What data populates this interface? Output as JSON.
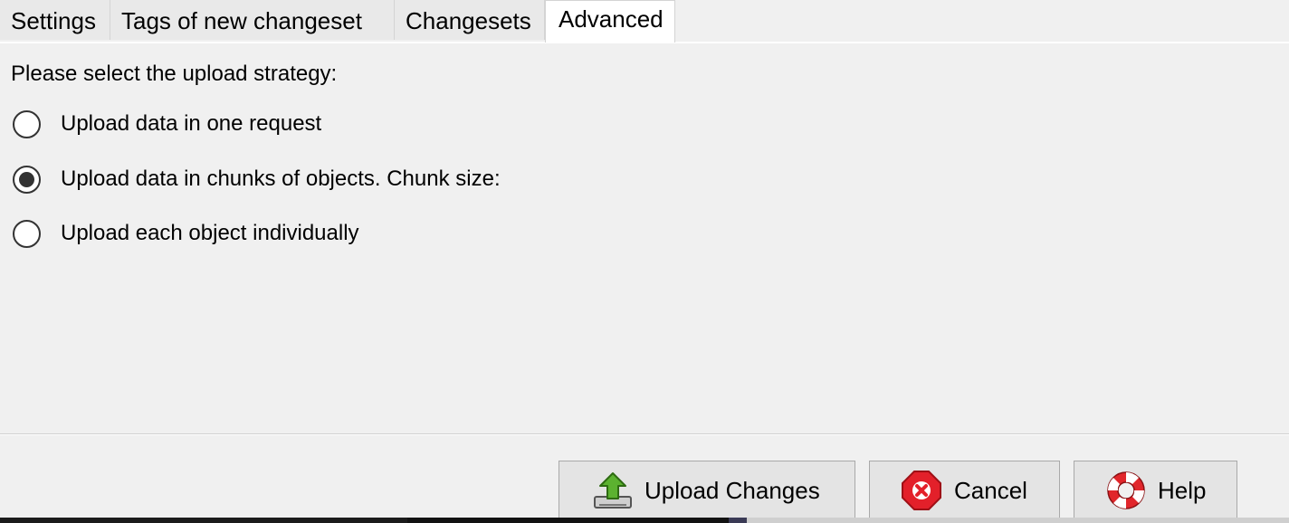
{
  "tabs": [
    {
      "label": "Settings",
      "active": false
    },
    {
      "label": "Tags of new changeset",
      "active": false
    },
    {
      "label": "Changesets",
      "active": false
    },
    {
      "label": "Advanced",
      "active": true
    }
  ],
  "advanced": {
    "prompt": "Please select the upload strategy:",
    "options": [
      {
        "label": "Upload data in one request",
        "selected": false
      },
      {
        "label": "Upload data in chunks of objects. Chunk size:",
        "selected": true
      },
      {
        "label": "Upload each object individually",
        "selected": false
      }
    ]
  },
  "buttons": {
    "upload": {
      "label": "Upload Changes",
      "icon": "upload-icon"
    },
    "cancel": {
      "label": "Cancel",
      "icon": "cancel-icon"
    },
    "help": {
      "label": "Help",
      "icon": "help-lifebuoy-icon"
    }
  },
  "colors": {
    "background": "#f0f0f0",
    "cancel_red": "#e3202a",
    "upload_green": "#5cb230",
    "help_red": "#e1262b"
  }
}
